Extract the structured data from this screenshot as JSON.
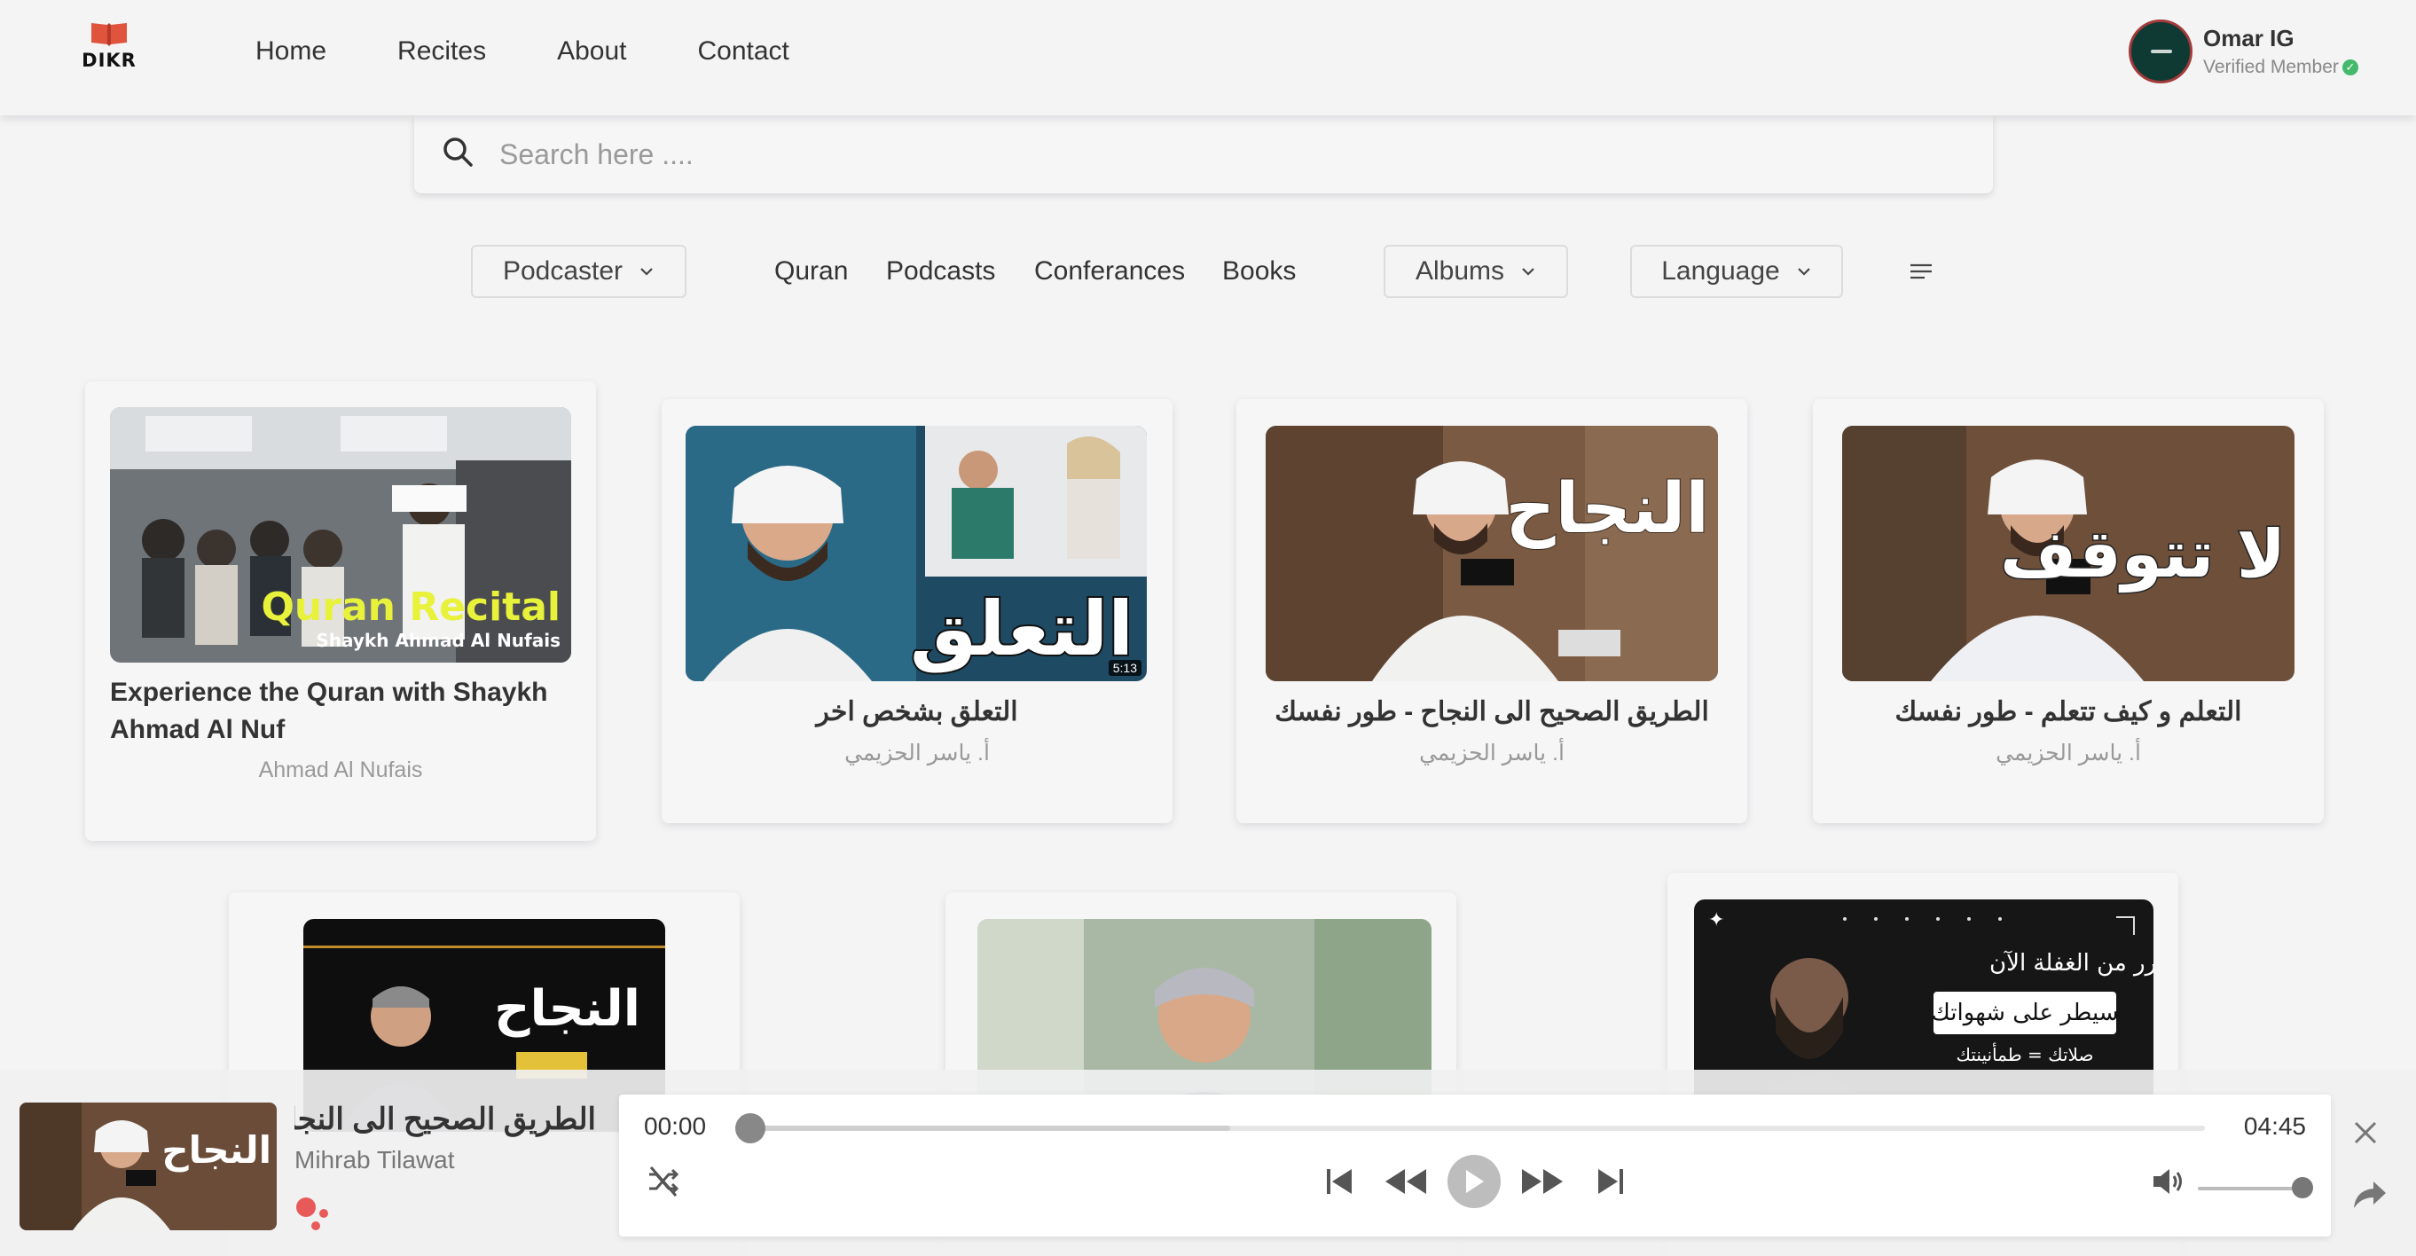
{
  "app": {
    "logo_text": "DIKR",
    "brand_color": "#e0533d"
  },
  "nav": {
    "items": [
      "Home",
      "Recites",
      "About",
      "Contact"
    ]
  },
  "user": {
    "name": "Omar IG",
    "status": "Verified Member"
  },
  "search": {
    "placeholder": "Search here ...."
  },
  "filters": {
    "podcaster": "Podcaster",
    "links": [
      "Quran",
      "Podcasts",
      "Conferances",
      "Books"
    ],
    "albums": "Albums",
    "language": "Language",
    "sort_icon": "sort-lines-icon"
  },
  "cards_row1": [
    {
      "title": "Experience the Quran with Shaykh Ahmad Al Nuf",
      "author": "Ahmad Al Nufais",
      "thumb_text": "Quran Recital",
      "thumb_sub": "Shaykh Ahmad Al Nufais"
    },
    {
      "title": "التعلق بشخص اخر",
      "author": "أ. ياسر الحزيمي",
      "thumb_text": "التعلق",
      "duration": "5:13"
    },
    {
      "title": "الطريق الصحيح الى النجاح - طور نفسك",
      "author": "أ. ياسر الحزيمي",
      "thumb_text": "النجاح"
    },
    {
      "title": "التعلم و كيف تتعلم - طور نفسك",
      "author": "أ. ياسر الحزيمي",
      "thumb_text": "لا تتوقف"
    }
  ],
  "cards_row2": [
    {
      "thumb_text": "النجاح"
    },
    {
      "thumb_text": ""
    },
    {
      "thumb_line1": "تحرر من الغفلة الآن",
      "thumb_line2": "سيطر على شهواتك",
      "thumb_line3": "صلاتك = طمأنينتك"
    }
  ],
  "player": {
    "title": "الطريق الصحيح الى النجاح - طور نفسك",
    "subtitle": "Mihrab Tilawat",
    "thumb_text": "النجاح",
    "current_time": "00:00",
    "total_time": "04:45",
    "progress": 0.0,
    "buffered": 0.33,
    "volume": 0.95
  }
}
